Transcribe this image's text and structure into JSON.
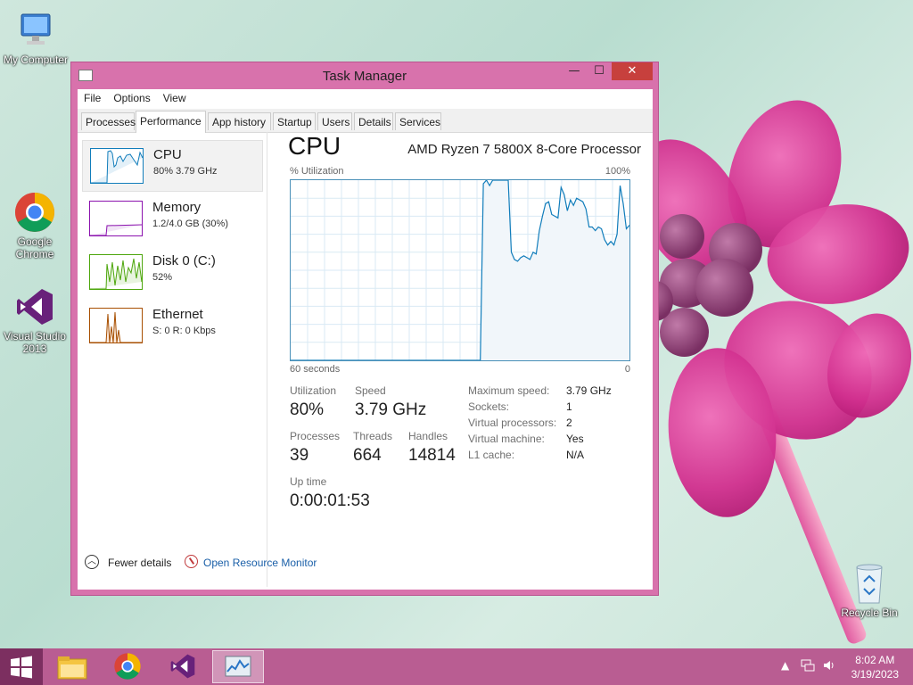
{
  "desktop": {
    "icons": [
      {
        "label": "My Computer"
      },
      {
        "label": "Google Chrome"
      },
      {
        "label": "Visual Studio 2013"
      },
      {
        "label": "Recycle Bin"
      }
    ]
  },
  "window": {
    "title": "Task Manager",
    "controls": {
      "minimize": "—",
      "maximize": "☐",
      "close": "✕"
    },
    "menu": [
      "File",
      "Options",
      "View"
    ],
    "tabs": [
      "Processes",
      "Performance",
      "App history",
      "Startup",
      "Users",
      "Details",
      "Services"
    ],
    "active_tab": "Performance",
    "resources": [
      {
        "name": "CPU",
        "sub": "80%  3.79 GHz",
        "color": "#117dbb"
      },
      {
        "name": "Memory",
        "sub": "1.2/4.0 GB (30%)",
        "color": "#8b12ae"
      },
      {
        "name": "Disk 0 (C:)",
        "sub": "52%",
        "color": "#4da60c"
      },
      {
        "name": "Ethernet",
        "sub": "S: 0  R: 0 Kbps",
        "color": "#a74f01"
      }
    ],
    "detail": {
      "title": "CPU",
      "processor": "AMD Ryzen 7 5800X 8-Core Processor",
      "graph_label": "% Utilization",
      "graph_max": "100%",
      "time_left": "60 seconds",
      "time_right": "0",
      "stats": {
        "utilization_label": "Utilization",
        "utilization": "80%",
        "speed_label": "Speed",
        "speed": "3.79 GHz",
        "processes_label": "Processes",
        "processes": "39",
        "threads_label": "Threads",
        "threads": "664",
        "handles_label": "Handles",
        "handles": "14814",
        "uptime_label": "Up time",
        "uptime": "0:00:01:53"
      },
      "specs": [
        {
          "k": "Maximum speed:",
          "v": "3.79 GHz"
        },
        {
          "k": "Sockets:",
          "v": "1"
        },
        {
          "k": "Virtual processors:",
          "v": "2"
        },
        {
          "k": "Virtual machine:",
          "v": "Yes"
        },
        {
          "k": "L1 cache:",
          "v": "N/A"
        }
      ],
      "cpu_history": [
        0,
        0,
        0,
        0,
        0,
        0,
        0,
        0,
        0,
        0,
        0,
        0,
        0,
        0,
        0,
        0,
        0,
        0,
        0,
        0,
        0,
        0,
        0,
        0,
        0,
        0,
        0,
        0,
        0,
        0,
        0,
        0,
        0,
        0,
        0,
        0,
        0,
        0,
        0,
        0,
        0,
        0,
        0,
        0,
        0,
        0,
        0,
        0,
        0,
        0,
        0,
        0,
        0,
        0,
        0,
        0,
        0,
        0,
        0,
        0,
        0,
        0,
        98,
        100,
        97,
        100,
        100,
        100,
        100,
        100,
        100,
        60,
        56,
        55,
        57,
        58,
        57,
        56,
        60,
        59,
        72,
        80,
        87,
        88,
        81,
        80,
        79,
        96,
        92,
        83,
        89,
        86,
        90,
        89,
        88,
        84,
        74,
        74,
        72,
        74,
        73,
        67,
        64,
        66,
        64,
        70,
        97,
        87,
        73,
        75
      ]
    },
    "footer": {
      "fewer": "Fewer details",
      "monitor": "Open Resource Monitor"
    }
  },
  "taskbar": {
    "time": "8:02 AM",
    "date": "3/19/2023",
    "apps": [
      "file-explorer",
      "google-chrome",
      "visual-studio",
      "task-manager"
    ]
  }
}
